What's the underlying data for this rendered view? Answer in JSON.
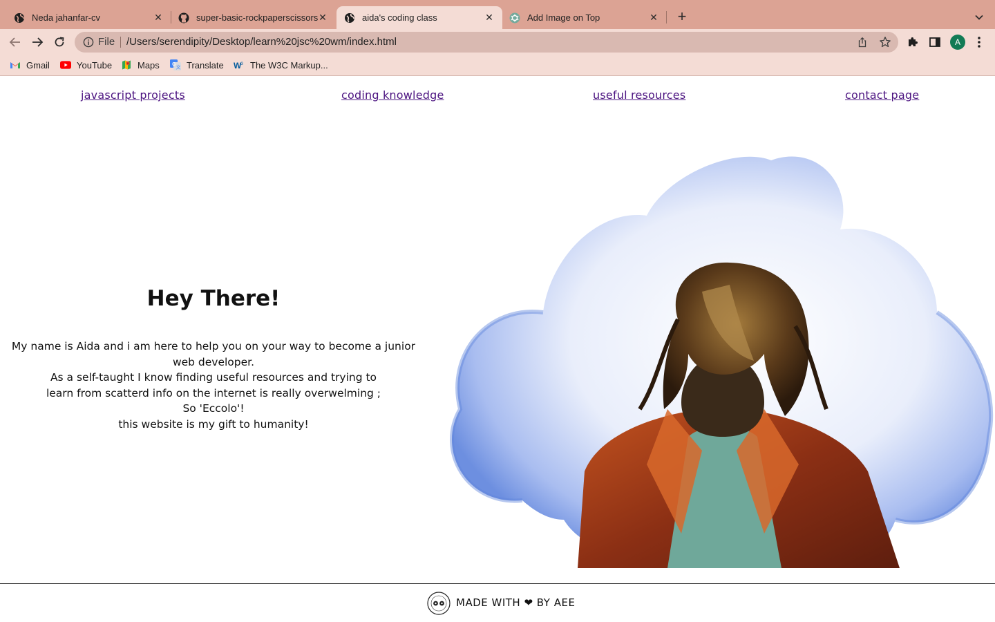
{
  "browser": {
    "tabs": [
      {
        "title": "Neda jahanfar-cv",
        "icon": "globe-icon"
      },
      {
        "title": "super-basic-rockpaperscissors",
        "icon": "github-icon"
      },
      {
        "title": "aida's coding class",
        "icon": "globe-icon",
        "active": true
      },
      {
        "title": "Add Image on Top",
        "icon": "chatgpt-icon"
      }
    ],
    "omnibox": {
      "scheme_label": "File",
      "url": "/Users/serendipity/Desktop/learn%20jsc%20wm/index.html"
    },
    "profile_initial": "A",
    "bookmarks": [
      {
        "label": "Gmail",
        "icon": "gmail-icon"
      },
      {
        "label": "YouTube",
        "icon": "youtube-icon"
      },
      {
        "label": "Maps",
        "icon": "maps-icon"
      },
      {
        "label": "Translate",
        "icon": "translate-icon"
      },
      {
        "label": "The W3C Markup...",
        "icon": "w3c-icon"
      }
    ],
    "colors": {
      "tabstrip": "#dca394",
      "toolbar": "#f4dcd5",
      "omnibox": "#d9b9b1"
    }
  },
  "page": {
    "nav": [
      {
        "label": "javascript projects"
      },
      {
        "label": "coding knowledge"
      },
      {
        "label": "useful resources"
      },
      {
        "label": "contact page"
      }
    ],
    "hero": {
      "title": "Hey There!",
      "lines": [
        "My name is Aida and i am here to help you on your way to become a junior web developer.",
        "As a self-taught I know finding useful resources and trying to learn from scatterd info on the internet is really overwelming ; So 'Eccolo'!",
        "this website is my gift to humanity!"
      ]
    },
    "footer": {
      "text": "MADE WITH ❤ BY AEE"
    },
    "colors": {
      "nav_link": "#4b1380",
      "text": "#111111",
      "cloud": "#8fa9ea"
    }
  }
}
